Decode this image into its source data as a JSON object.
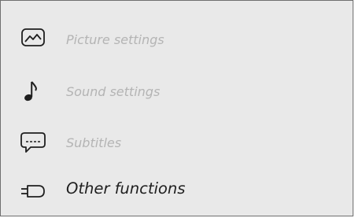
{
  "menu": {
    "items": [
      {
        "label": "Picture settings",
        "icon": "picture-icon",
        "state": "inactive"
      },
      {
        "label": "Sound settings",
        "icon": "music-note-icon",
        "state": "inactive"
      },
      {
        "label": "Subtitles",
        "icon": "subtitles-icon",
        "state": "inactive"
      },
      {
        "label": "Other functions",
        "icon": "plug-icon",
        "state": "active"
      }
    ]
  },
  "colors": {
    "panel_background": "#e9e9e9",
    "panel_border": "#6f6f6f",
    "inactive_text": "#b4b4b4",
    "active_text": "#1f1f1f",
    "icon": "#1f1f1f"
  }
}
